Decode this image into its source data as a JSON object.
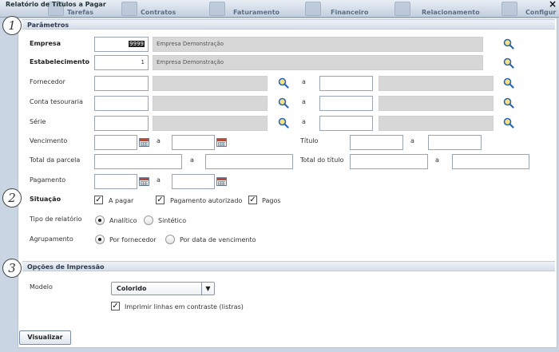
{
  "navbar": {
    "tabs": [
      {
        "label": "Tarefas",
        "icon": "tasks-icon"
      },
      {
        "label": "Contratos",
        "icon": "contracts-icon"
      },
      {
        "label": "Faturamento",
        "icon": "billing-icon"
      },
      {
        "label": "Financeiro",
        "icon": "finance-icon"
      },
      {
        "label": "Relacionamento",
        "icon": "relationship-icon"
      },
      {
        "label": "Configur",
        "icon": "settings-icon"
      }
    ]
  },
  "dialog": {
    "title": "Relatório de Títulos a Pagar",
    "close": "×"
  },
  "annotations": [
    "1",
    "2",
    "3"
  ],
  "parametros": {
    "header": "Parâmetros",
    "empresa": {
      "label": "Empresa",
      "code": "9999",
      "name": "Empresa Demonstração"
    },
    "estabelecimento": {
      "label": "Estabelecimento",
      "code": "1",
      "name": "Empresa Demonstração"
    },
    "fornecedor": {
      "label": "Fornecedor",
      "sep": "a"
    },
    "conta": {
      "label": "Conta tesouraria",
      "sep": "a"
    },
    "serie": {
      "label": "Série",
      "sep": "a"
    },
    "vencimento": {
      "label": "Vencimento",
      "sep": "a"
    },
    "titulo": {
      "label": "Título",
      "sep": "a"
    },
    "total_parcela": {
      "label": "Total da parcela",
      "sep": "a"
    },
    "total_titulo": {
      "label": "Total do título",
      "sep": "a"
    },
    "pagamento": {
      "label": "Pagamento",
      "sep": "a"
    },
    "situacao": {
      "label": "Situação",
      "options": [
        {
          "label": "A pagar",
          "checked": true
        },
        {
          "label": "Pagamento autorizado",
          "checked": true
        },
        {
          "label": "Pagos",
          "checked": true
        }
      ]
    },
    "tipo_relatorio": {
      "label": "Tipo de relatório",
      "options": [
        {
          "label": "Analítico",
          "selected": true
        },
        {
          "label": "Sintético",
          "selected": false
        }
      ]
    },
    "agrupamento": {
      "label": "Agrupamento",
      "options": [
        {
          "label": "Por fornecedor",
          "selected": true
        },
        {
          "label": "Por data de vencimento",
          "selected": false
        }
      ]
    }
  },
  "impressao": {
    "header": "Opções de Impressão",
    "modelo_label": "Modelo",
    "modelo_value": "Colorido",
    "contraste_label": "Imprimir linhas em contraste (listras)",
    "contraste_checked": true
  },
  "actions": {
    "visualizar": "Visualizar"
  },
  "glyphs": {
    "check": "✓",
    "dropdown": "▼"
  }
}
